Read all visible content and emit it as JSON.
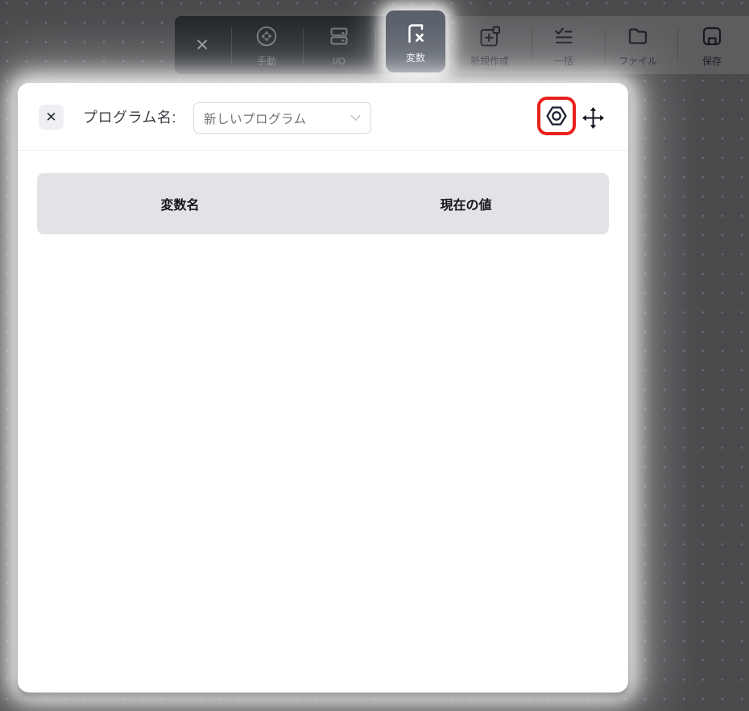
{
  "toolbar": {
    "close_glyph": "✕",
    "left_items": [
      {
        "label": "手動",
        "icon": "dpad-icon"
      },
      {
        "label": "I/O",
        "icon": "io-panel-icon"
      },
      {
        "label": "変数",
        "icon": "fx-variable-icon",
        "active": true
      }
    ],
    "right_items": [
      {
        "label": "新規作成",
        "icon": "new-document-icon"
      },
      {
        "label": "一括",
        "icon": "batch-list-icon"
      },
      {
        "label": "ファイル",
        "icon": "file-folder-icon"
      },
      {
        "label": "保存",
        "icon": "save-disk-icon"
      }
    ]
  },
  "modal": {
    "close_glyph": "✕",
    "program_name_label": "プログラム名:",
    "program_select": {
      "value": "新しいプログラム"
    },
    "table": {
      "columns": [
        {
          "label": "変数名"
        },
        {
          "label": "現在の値"
        }
      ],
      "rows": []
    }
  },
  "colors": {
    "highlight_ring_red": "#e7211d",
    "spotlight_glow": "#ffffff",
    "canvas_background": "#4a4a4d"
  }
}
